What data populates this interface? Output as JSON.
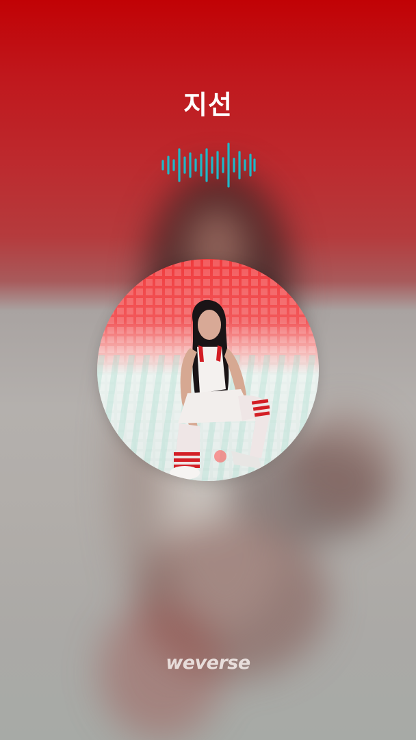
{
  "title": "지선",
  "brand": "weverse",
  "waveform_icon": "audio-waveform-icon",
  "colors": {
    "top_red": "#c10205",
    "wave": "#1fb8c8",
    "text": "#ffffff"
  }
}
